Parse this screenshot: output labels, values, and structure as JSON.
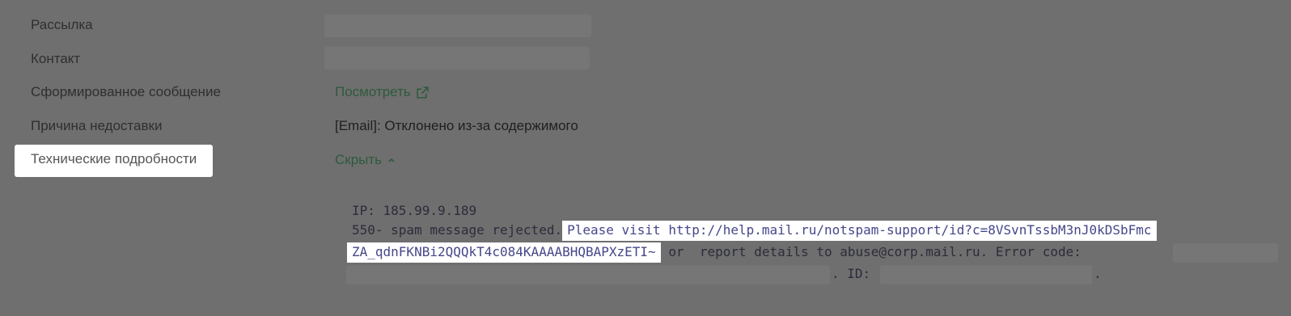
{
  "rows": [
    {
      "label": "Рассылка"
    },
    {
      "label": "Контакт"
    },
    {
      "label": "Сформированное сообщение",
      "value": "Посмотреть"
    },
    {
      "label": "Причина недоставки",
      "value": "[Email]: Отклонено из-за содержимого"
    },
    {
      "label": "Технические подробности",
      "value": "Скрыть"
    }
  ],
  "icons": {
    "external_link": "external-link-icon",
    "chevron_up": "chevron-up-icon"
  },
  "details": {
    "ip_line": "IP: 185.99.9.189",
    "line2_prefix": "550- spam message rejected.",
    "line2_highlight": "Please visit http://help.mail.ru/notspam-support/id?c=8VSvnTssbM3nJ0kDSbFmc",
    "line3_highlight": "ZA_qdnFKNBi2QQQkT4c084KAAAABHQBAPXzETI~",
    "line3_rest": " or  report details to abuse@corp.mail.ru. Error code:",
    "line4_id": ". ID:",
    "line4_end": "."
  },
  "colors": {
    "overlay": "#6f6f6f",
    "link": "#2e5a3c",
    "highlight_text": "#45478a"
  }
}
